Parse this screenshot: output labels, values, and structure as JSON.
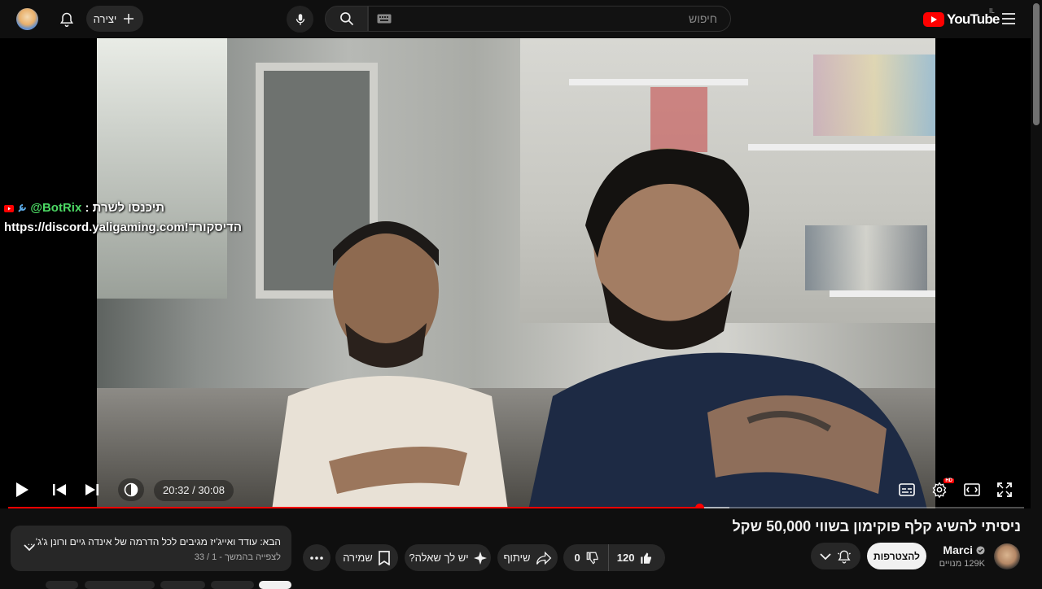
{
  "header": {
    "logo_text": "YouTube",
    "country_code": "IL",
    "search_placeholder": "חיפוש",
    "create_label": "יצירה"
  },
  "overlay": {
    "line1_user": "@BotRix",
    "line1_text": ": תיכנסו לשרת",
    "line2_text": "https://discord.yaligaming.com!הדיסקורד"
  },
  "player": {
    "time_current": "20:32",
    "time_separator": " / ",
    "time_total": "30:08",
    "progress_fraction": 0.68,
    "buffered_fraction": 0.71
  },
  "video": {
    "title": "ניסיתי להשיג קלף פוקימון בשווי 50,000 שקל"
  },
  "channel": {
    "name": "Marci",
    "subscribers": "129K מנויים",
    "subscribe_label": "להצטרפות"
  },
  "actions": {
    "likes": "120",
    "dislikes": "0",
    "share_label": "שיתוף",
    "ask_label": "יש לך שאלה?",
    "save_label": "שמירה"
  },
  "up_next": {
    "title": "הבא: עודד ואייג'יז מגיבים לכל הדרמה של אינדה גיים ורונן ג'ג'...",
    "subtitle": "לצפייה בהמשך - 1 / 33"
  },
  "colors": {
    "accent": "#ff0000",
    "background": "#0f0f0f",
    "surface": "#272727"
  }
}
